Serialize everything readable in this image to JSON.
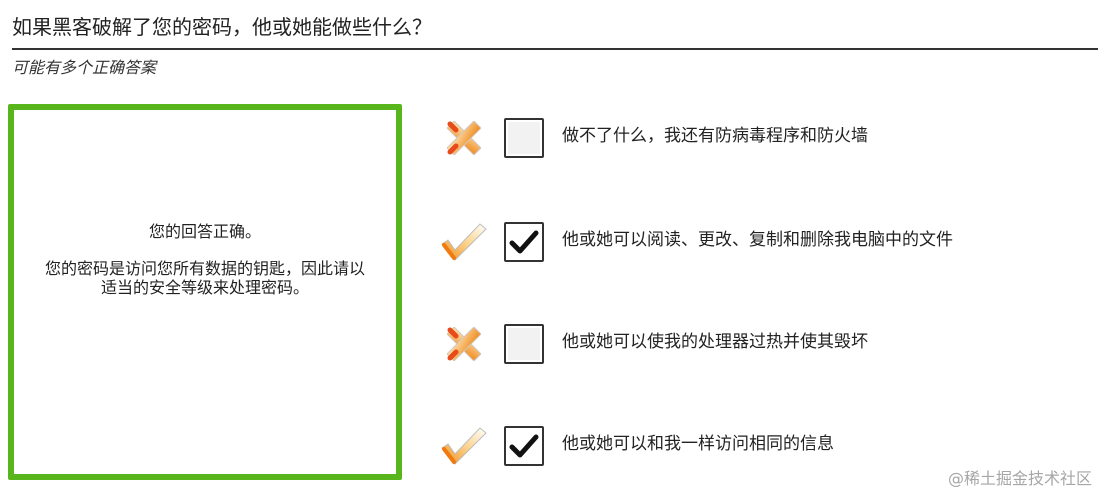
{
  "question": {
    "title": "如果黑客破解了您的密码，他或她能做些什么？",
    "hint": "可能有多个正确答案"
  },
  "feedback": {
    "status": "您的回答正确。",
    "explanation": "您的密码是访问您所有数据的钥匙，因此请以适当的安全等级来处理密码。",
    "border_color": "#58b51c"
  },
  "options": [
    {
      "label": "做不了什么，我还有防病毒程序和防火墙",
      "checked": false,
      "mark": "cross-icon"
    },
    {
      "label": "他或她可以阅读、更改、复制和删除我电脑中的文件",
      "checked": true,
      "mark": "check-icon"
    },
    {
      "label": "他或她可以使我的处理器过热并使其毁坏",
      "checked": false,
      "mark": "cross-icon"
    },
    {
      "label": "他或她可以和我一样访问相同的信息",
      "checked": true,
      "mark": "check-icon"
    }
  ],
  "watermark": "@稀土掘金技术社区"
}
